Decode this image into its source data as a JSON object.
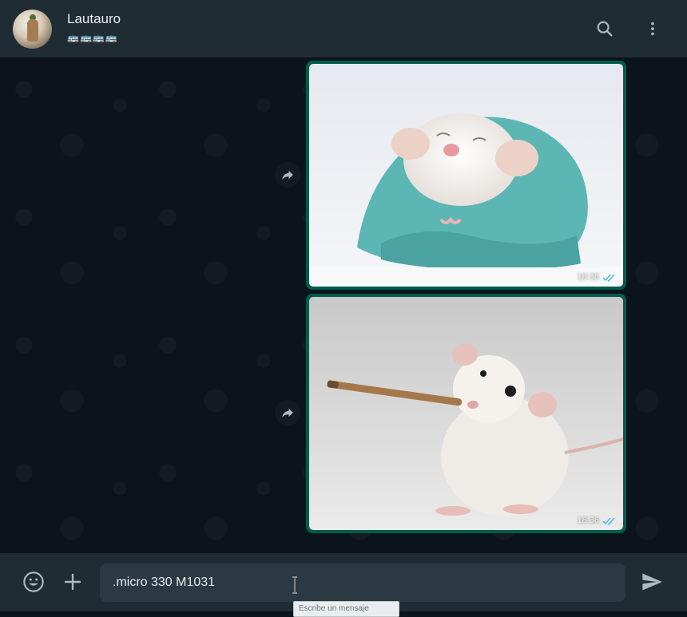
{
  "header": {
    "contact_name": "Lautauro",
    "status": "🚌🚌🚌🚌"
  },
  "messages": [
    {
      "type": "image",
      "subject": "rat-in-blanket",
      "time": "18:36",
      "read_status": "double-check-read"
    },
    {
      "type": "image",
      "subject": "rat-playing-flute",
      "time": "18:36",
      "read_status": "double-check-read"
    }
  ],
  "composer": {
    "input_value": ".micro 330 M1031",
    "tooltip": "Escribe un mensaje"
  },
  "colors": {
    "header_bg": "#202c33",
    "chat_bg": "#0b141a",
    "outgoing_bubble": "#005c4b",
    "input_bg": "#2a3942",
    "read_ticks": "#53bdeb",
    "icon": "#aebac1"
  }
}
